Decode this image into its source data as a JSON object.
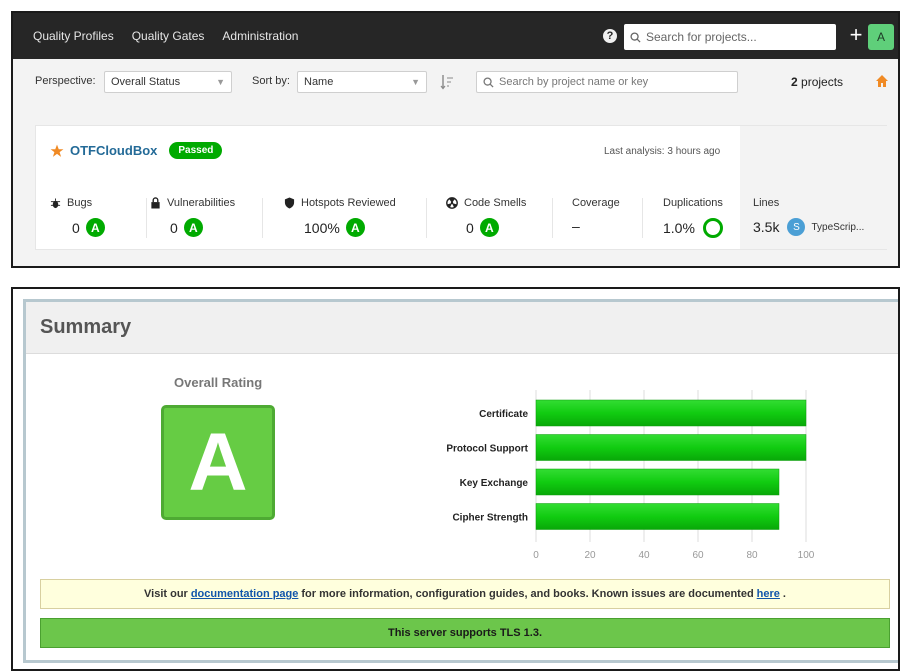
{
  "sonar": {
    "nav": [
      "Quality Profiles",
      "Quality Gates",
      "Administration"
    ],
    "search_placeholder": "Search for projects...",
    "avatar": "A",
    "help": "?",
    "plus": "+",
    "perspective_label": "Perspective:",
    "perspective_value": "Overall Status",
    "sortby_label": "Sort by:",
    "sortby_value": "Name",
    "project_search_placeholder": "Search by project name or key",
    "project_count": "2",
    "project_count_suffix": "projects",
    "project": {
      "name": "OTFCloudBox",
      "status": "Passed",
      "last_analysis": "Last analysis: 3 hours ago",
      "metrics": {
        "bugs": {
          "label": "Bugs",
          "value": "0",
          "rating": "A"
        },
        "vulnerabilities": {
          "label": "Vulnerabilities",
          "value": "0",
          "rating": "A"
        },
        "hotspots": {
          "label": "Hotspots Reviewed",
          "value": "100%",
          "rating": "A"
        },
        "code_smells": {
          "label": "Code Smells",
          "value": "0",
          "rating": "A"
        },
        "coverage": {
          "label": "Coverage",
          "value": "–"
        },
        "duplications": {
          "label": "Duplications",
          "value": "1.0%"
        },
        "lines": {
          "label": "Lines",
          "value": "3.5k",
          "lang_badge": "S",
          "lang": "TypeScrip..."
        }
      }
    },
    "colors": {
      "topbar": "#262626",
      "rating_green": "#00aa00",
      "link": "#236a97",
      "star": "#f08a24"
    }
  },
  "ssl": {
    "title": "Summary",
    "overall_label": "Overall Rating",
    "grade": "A",
    "notice": {
      "part1": "Visit our",
      "link1": "documentation page",
      "part2": "for more information, configuration guides, and books. Known issues are documented",
      "link2": "here",
      "part3": "."
    },
    "tls_message": "This server supports TLS 1.3.",
    "colors": {
      "bar": "#11cc11",
      "grade": "#66cc44",
      "notice_bg": "#ffffdd",
      "tls_bg": "#6cc64b"
    }
  },
  "chart_data": {
    "type": "bar",
    "orientation": "horizontal",
    "categories": [
      "Certificate",
      "Protocol Support",
      "Key Exchange",
      "Cipher Strength"
    ],
    "values": [
      100,
      100,
      90,
      90
    ],
    "xlim": [
      0,
      100
    ],
    "xticks": [
      0,
      20,
      40,
      60,
      80,
      100
    ],
    "grid": true
  }
}
